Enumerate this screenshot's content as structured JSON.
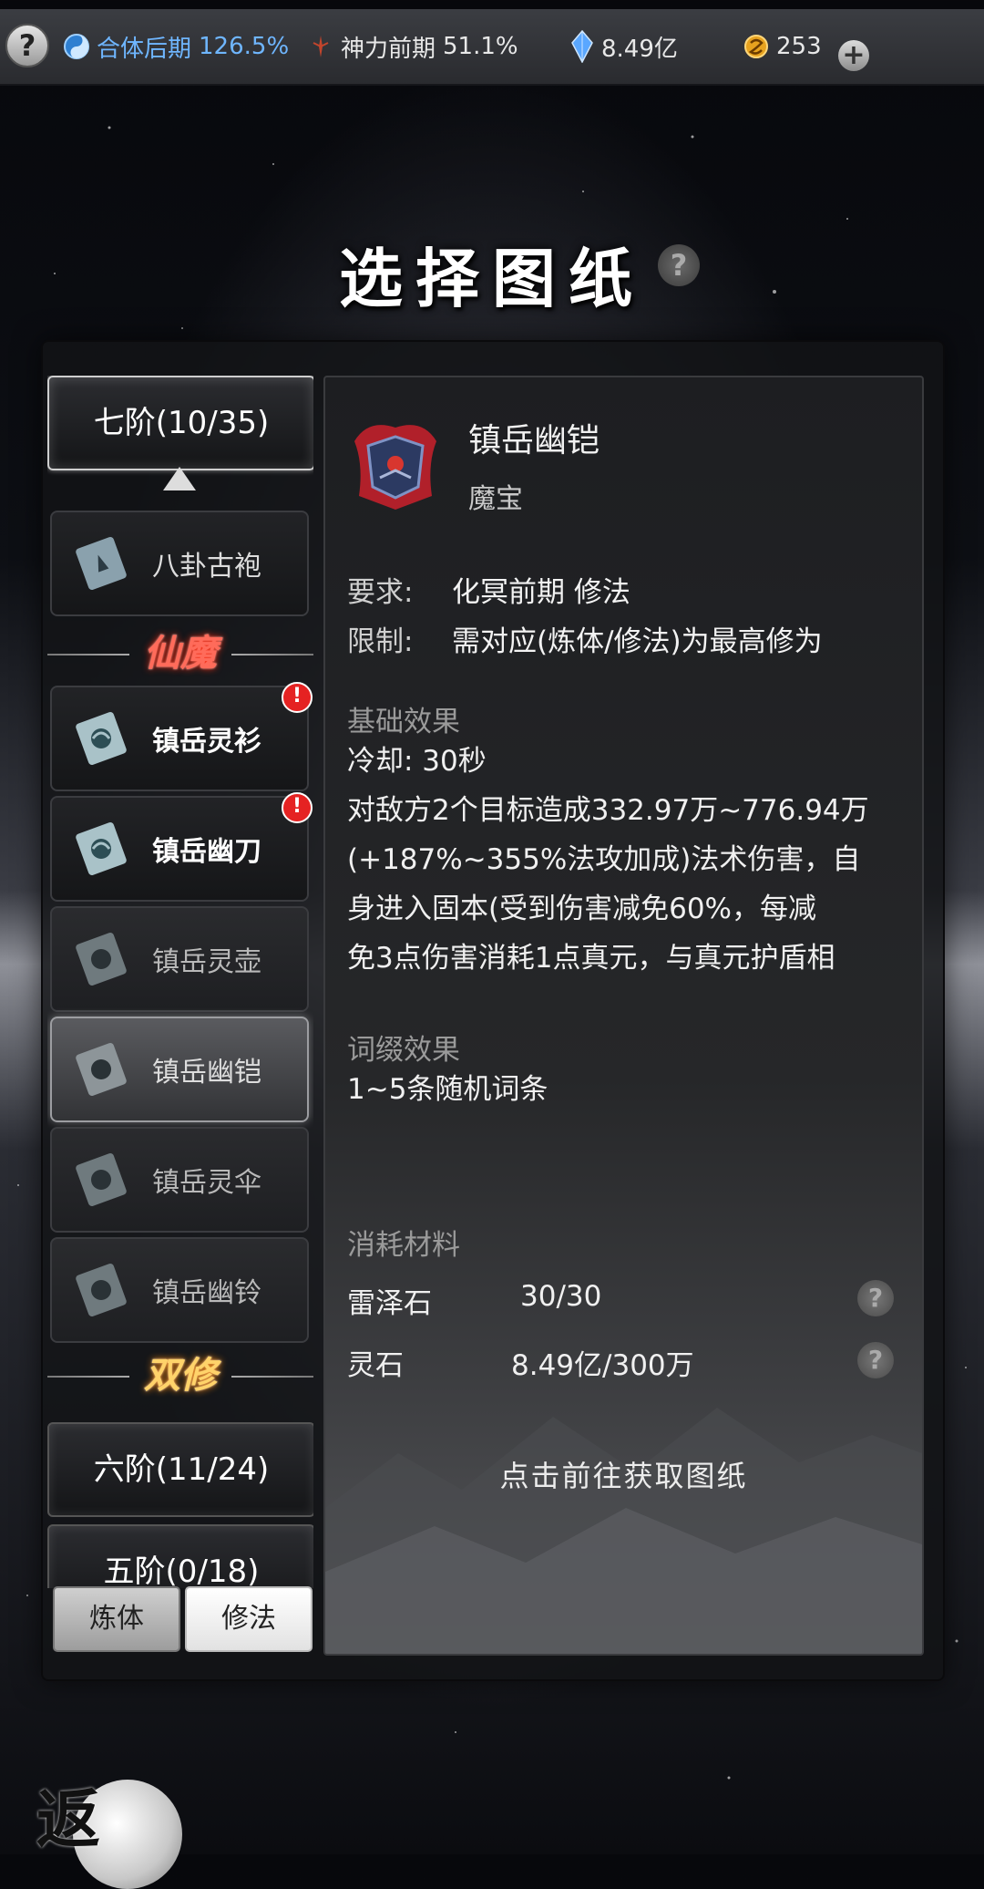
{
  "topbar": {
    "help": "?",
    "realm_label": "合体后期",
    "realm_pct": "126.5%",
    "divine_label": "神力前期",
    "divine_pct": "51.1%",
    "spirit_stone": "8.49亿",
    "currency": "253",
    "plus": "+"
  },
  "title": "选择图纸",
  "title_help": "?",
  "sidebar": {
    "tier_active": "七阶(10/35)",
    "items_top": [
      {
        "label": "八卦古袍"
      }
    ],
    "section_1": "仙魔",
    "items": [
      {
        "label": "镇岳灵衫",
        "alert": "!"
      },
      {
        "label": "镇岳幽刀",
        "alert": "!"
      },
      {
        "label": "镇岳灵壶"
      },
      {
        "label": "镇岳幽铠"
      },
      {
        "label": "镇岳灵伞"
      },
      {
        "label": "镇岳幽铃"
      }
    ],
    "section_2": "双修",
    "tier_2": "六阶(11/24)",
    "tier_3": "五阶(0/18)"
  },
  "tabs": {
    "body": "炼体",
    "magic": "修法"
  },
  "detail": {
    "name": "镇岳幽铠",
    "type": "魔宝",
    "req_label": "要求:",
    "req_value": "化冥前期 修法",
    "limit_label": "限制:",
    "limit_value": "需对应(炼体/修法)为最高修为",
    "base_title": "基础效果",
    "cooldown": "冷却: 30秒",
    "base_line_1": "对敌方2个目标造成332.97万~776.94万",
    "base_line_2": "(+187%~355%法攻加成)法术伤害，自",
    "base_line_3": "身进入固本(受到伤害减免60%，每减",
    "base_line_4": "免3点伤害消耗1点真元，与真元护盾相",
    "affix_title": "词缀效果",
    "affix_value": "1~5条随机词条",
    "materials_title": "消耗材料",
    "materials": [
      {
        "name": "雷泽石",
        "qty": "30/30",
        "help": "?"
      },
      {
        "name": "灵石",
        "qty": "8.49亿/300万",
        "help": "?"
      }
    ],
    "goto": "点击前往获取图纸"
  },
  "return_label": "返"
}
